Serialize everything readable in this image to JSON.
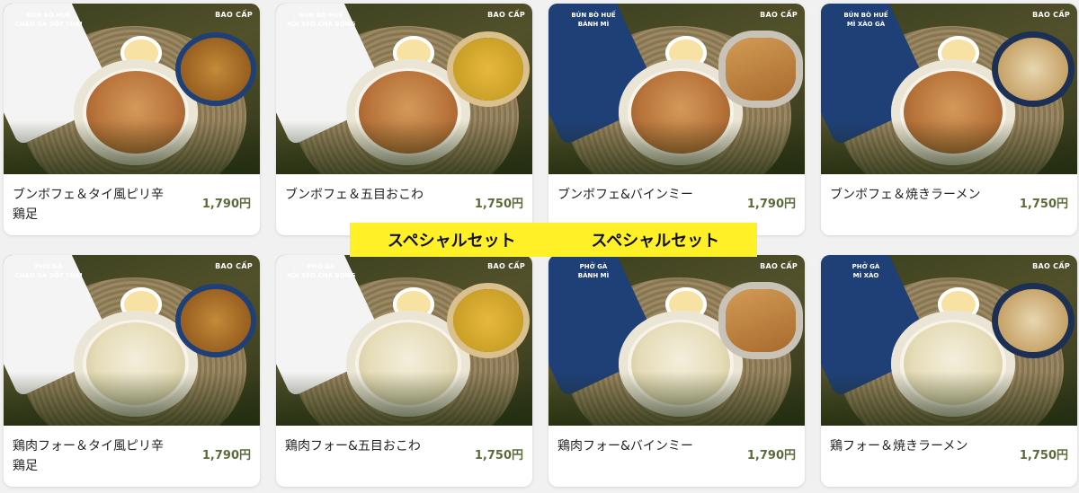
{
  "banner": {
    "left_text": "スペシャルセット",
    "right_text": "スペシャルセット",
    "color": "#fff028"
  },
  "price_color": "#5b6b3a",
  "brand_label": "BAO CẤP",
  "items": [
    {
      "caption1": "BÚN BÒ HUẾ",
      "caption2": "CHÂN GÀ SỐT THÁI",
      "name": "ブンボフェ＆タイ風ピリ辛鶏足",
      "price": "1,790円",
      "soup": "bun",
      "side": "chicken",
      "plate": "white"
    },
    {
      "caption1": "BÚN BÒ HUẾ",
      "caption2": "XÔI XÉO CHÀ BÔNG",
      "name": "ブンボフェ＆五目おこわ",
      "price": "1,750円",
      "soup": "bun",
      "side": "xoi",
      "plate": "white"
    },
    {
      "caption1": "BÚN BÒ HUẾ",
      "caption2": "BÁNH MÌ",
      "name": "ブンボフェ&バインミー",
      "price": "1,790円",
      "soup": "bun",
      "side": "banhmi",
      "plate": "blue"
    },
    {
      "caption1": "BÚN BÒ HUẾ",
      "caption2": "MÌ XÀO GÀ",
      "name": "ブンボフェ＆焼きラーメン",
      "price": "1,750円",
      "soup": "bun",
      "side": "noodle",
      "plate": "blue"
    },
    {
      "caption1": "PHỞ GÀ",
      "caption2": "CHÂN GÀ SỐT THÁI",
      "name": "鶏肉フォー＆タイ風ピリ辛鶏足",
      "price": "1,790円",
      "soup": "pho",
      "side": "chicken",
      "plate": "white"
    },
    {
      "caption1": "PHỞ GÀ",
      "caption2": "XÔI XÉO CHÀ BÔNG",
      "name": "鶏肉フォー&五目おこわ",
      "price": "1,750円",
      "soup": "pho",
      "side": "xoi",
      "plate": "white"
    },
    {
      "caption1": "PHỞ GÀ",
      "caption2": "BÁNH MÌ",
      "name": "鶏肉フォー&バインミー",
      "price": "1,790円",
      "soup": "pho",
      "side": "banhmi",
      "plate": "blue"
    },
    {
      "caption1": "PHỞ GÀ",
      "caption2": "MÌ XÀO",
      "name": "鶏フォー＆焼きラーメン",
      "price": "1,750円",
      "soup": "pho",
      "side": "noodle",
      "plate": "blue"
    }
  ]
}
